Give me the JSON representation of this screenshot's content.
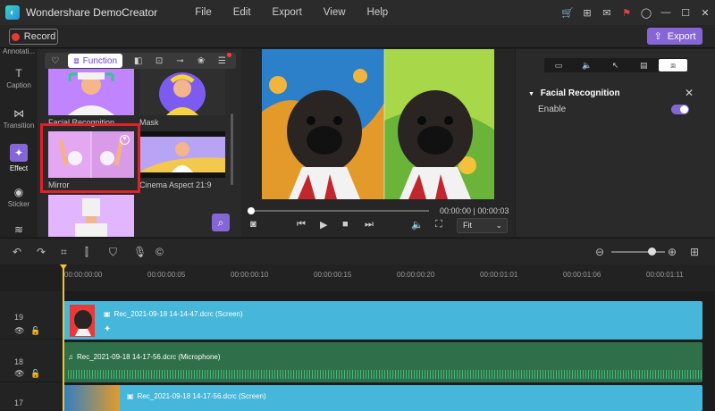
{
  "app": {
    "title": "Wondershare DemoCreator",
    "menu": [
      "File",
      "Edit",
      "Export",
      "View",
      "Help"
    ]
  },
  "toolbar": {
    "record_label": "Record",
    "export_label": "Export"
  },
  "left_nav": [
    {
      "label": "Annotati..."
    },
    {
      "label": "Caption"
    },
    {
      "label": "Transition"
    },
    {
      "label": "Effect",
      "active": true
    },
    {
      "label": "Sticker"
    }
  ],
  "effects": {
    "active_tab": "Function",
    "cards": [
      {
        "label": "Facial Recognition"
      },
      {
        "label": "Mask"
      },
      {
        "label": "Mirror",
        "selected": true
      },
      {
        "label": "Cinema Aspect 21:9"
      },
      {
        "label": ""
      }
    ]
  },
  "preview": {
    "timecode": "00:00:00 | 00:00:03",
    "fit_value": "Fit",
    "progress": 0
  },
  "properties": {
    "section_title": "Facial Recognition",
    "enable_label": "Enable",
    "enabled": true
  },
  "timeline": {
    "ruler": [
      "00:00:00:00",
      "00:00:00:05",
      "00:00:00:10",
      "00:00:00:15",
      "00:00:00:20",
      "00:00:01:01",
      "00:00:01:06",
      "00:00:01:11"
    ],
    "zoom": 0.75,
    "tracks": [
      {
        "number": "19",
        "clip": "Rec_2021-09-18 14-14-47.dcrc (Screen)",
        "type": "screen"
      },
      {
        "number": "18",
        "clip": "Rec_2021-09-18 14-17-56.dcrc (Microphone)",
        "type": "audio"
      },
      {
        "number": "17",
        "clip": "Rec_2021-09-18 14-17-56.dcrc (Screen)",
        "type": "screen"
      }
    ]
  },
  "colors": {
    "accent": "#8566d6",
    "highlight": "#e3202a",
    "screen_clip": "#46b7da",
    "audio_clip": "#2f6f4a",
    "playhead": "#f4c430"
  }
}
